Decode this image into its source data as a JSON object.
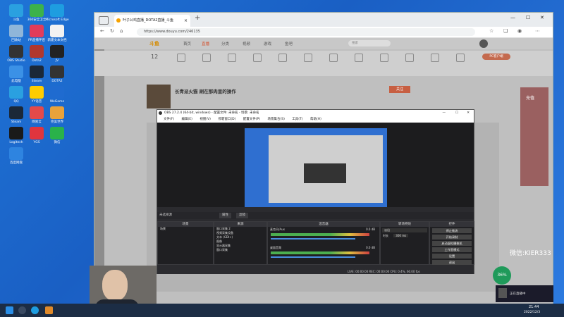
{
  "desktop": {
    "icons": [
      {
        "label": "斗鱼",
        "color": "#2aa0e0"
      },
      {
        "label": "360安全卫士",
        "color": "#3cb24a"
      },
      {
        "label": "Microsoft Edge",
        "color": "#1e9de0"
      },
      {
        "label": "回收站",
        "color": "#8fb6d9"
      },
      {
        "label": "PR直播伴侣",
        "color": "#e23c5a"
      },
      {
        "label": "新建文本文档",
        "color": "#f2f2f2"
      },
      {
        "label": "OBS Studio",
        "color": "#333333"
      },
      {
        "label": "Dota2",
        "color": "#b0382d"
      },
      {
        "label": "JV",
        "color": "#222222"
      },
      {
        "label": "此电脑",
        "color": "#3b91e6"
      },
      {
        "label": "Steam",
        "color": "#1b2838"
      },
      {
        "label": "DOTA2",
        "color": "#333333"
      },
      {
        "label": "QQ",
        "color": "#2aa0e0"
      },
      {
        "label": "YY语音",
        "color": "#ffcc00"
      },
      {
        "label": "WeGame",
        "color": "#1f6bd0"
      },
      {
        "label": "Steam",
        "color": "#1b2838"
      },
      {
        "label": "网易云",
        "color": "#e34a4a"
      },
      {
        "label": "完美世界",
        "color": "#e9a23b"
      },
      {
        "label": "Logitech",
        "color": "#1a1a1a"
      },
      {
        "label": "YGS",
        "color": "#e0353e"
      },
      {
        "label": "微信",
        "color": "#2ab24a"
      },
      {
        "label": "百度网盘",
        "color": "#2e84e0"
      }
    ]
  },
  "browser": {
    "tab_title": "叶子公鸡直播_DOTA2直播_斗鱼",
    "tab_close": "×",
    "new_tab": "+",
    "url": "https://www.douyu.com/246135",
    "window_controls": {
      "min": "—",
      "max": "☐",
      "close": "✕"
    }
  },
  "site": {
    "logo": "斗鱼",
    "nav": [
      "首页",
      "直播",
      "分类",
      "视频",
      "游戏",
      "鱼吧"
    ],
    "search_placeholder": "搜索",
    "count": "12",
    "stream_title": "长青派火猫 刷在那肉里的操作",
    "follow_button": "关注",
    "side_banner": "充值",
    "pc_button": "PC客户端"
  },
  "obs": {
    "title": "OBS 27.2.4 (64-bit, windows) - 配置文件: 未命名 - 场景: 未命名",
    "menu": [
      "文件(F)",
      "编辑(E)",
      "视图(V)",
      "停靠窗口(D)",
      "配置文件(P)",
      "场景集合(S)",
      "工具(T)",
      "帮助(H)"
    ],
    "no_source": "未选择源",
    "props_label": "属性",
    "filters_label": "滤镜",
    "scenes_header": "场景",
    "scenes": [
      "场景"
    ],
    "sources_header": "来源",
    "sources": [
      "窗口采集 2",
      "视频采集设备",
      "文本 (GDI+)",
      "图像",
      "显示器采集",
      "窗口采集"
    ],
    "mixer_header": "混音器",
    "mixer": [
      {
        "name": "桌面音频",
        "db": "0.0 dB"
      },
      {
        "name": "麦克风/Aux",
        "db": "0.0 dB"
      }
    ],
    "transition_header": "转场特效",
    "transition_value": "淡出",
    "duration_label": "时长",
    "duration_value": "300 ms",
    "controls_header": "控件",
    "controls": [
      "停止推流",
      "开始录制",
      "启动虚拟摄像机",
      "工作室模式",
      "设置",
      "退出"
    ],
    "status": "LIVE: 00:00:00    REC: 00:00:00    CPU: 0.4%, 60.00 fps"
  },
  "overlay": {
    "watermark": "微信:KIER333",
    "badge_percent": "36%",
    "notif_text": "正在直播中",
    "clock_time": "21:44",
    "clock_date": "2022/12/3"
  }
}
